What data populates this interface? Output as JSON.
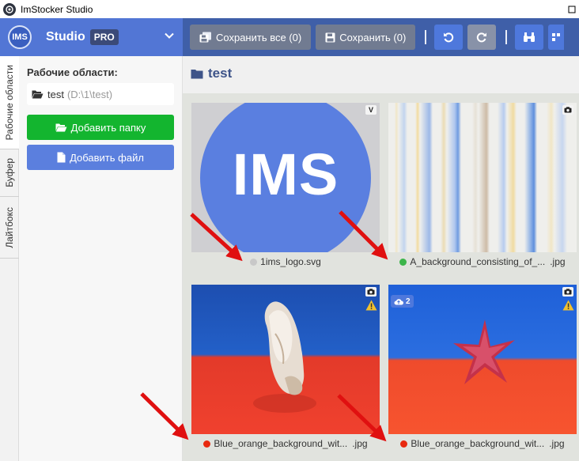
{
  "window": {
    "title": "ImStocker Studio",
    "control_icon": "maximize-icon"
  },
  "brand": {
    "logo_text": "IMS",
    "name": "Studio",
    "badge": "PRO"
  },
  "toolbar": {
    "save_all_label": "Сохранить все (0)",
    "save_label": "Сохранить (0)"
  },
  "left_tabs": [
    {
      "label": "Рабочие области"
    },
    {
      "label": "Буфер"
    },
    {
      "label": "Лайтбокс"
    }
  ],
  "sidebar": {
    "title": "Рабочие области:",
    "workspace": {
      "name": "test",
      "path": "(D:\\1\\test)"
    },
    "add_folder_label": "Добавить папку",
    "add_file_label": "Добавить файл"
  },
  "main": {
    "folder_title": "test"
  },
  "files": [
    {
      "name": "1ims_logo.svg",
      "ext": "",
      "status_color": "#c8c8c8",
      "type": "vector",
      "thumb_text": "IMS"
    },
    {
      "name": "A_background_consisting_of_...",
      "ext": ".jpg",
      "status_color": "#3cb54a",
      "type": "photo"
    },
    {
      "name": "Blue_orange_background_wit...",
      "ext": ".jpg",
      "status_color": "#e8290f",
      "type": "photo"
    },
    {
      "name": "Blue_orange_background_wit...",
      "ext": ".jpg",
      "status_color": "#e8290f",
      "type": "photo",
      "cloud_count": "2"
    }
  ],
  "colors": {
    "header_bg": "#3f5fa8",
    "brand_bg": "#5276d5",
    "green_button": "#13b52f",
    "blue_button": "#5b7fde",
    "annotation_arrow": "#e01010"
  }
}
